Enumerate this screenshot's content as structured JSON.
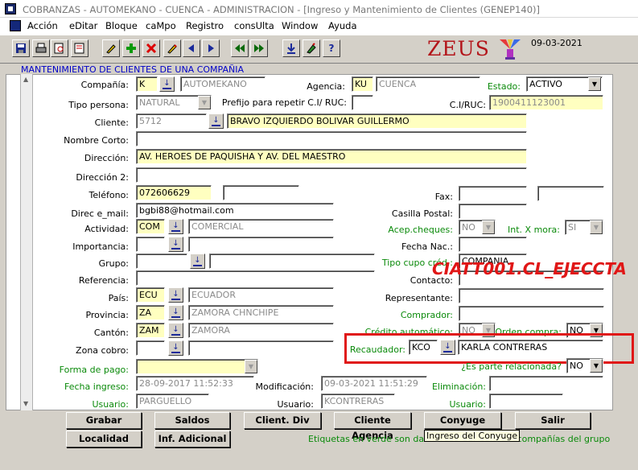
{
  "window": {
    "title": "COBRANZAS - AUTOMEKANO - CUENCA - ADMINISTRACION - [Ingreso y Mantenimiento de Clientes  (GENEP140)]"
  },
  "menu": [
    "Acción",
    "eDitar",
    "Bloque",
    "caMpo",
    "Registro",
    "consUlta",
    "Window",
    "Ayuda"
  ],
  "toolbar": {
    "icons": [
      "save-icon",
      "print-icon",
      "print-preview-icon",
      "search-icon",
      "add-record-icon",
      "delete-record-icon",
      "edit-icon",
      "previous-icon",
      "next-icon",
      "first-icon",
      "last-icon",
      "download-icon",
      "pen-icon",
      "help-icon"
    ],
    "brand": "ZEUS",
    "date": "09-03-2021"
  },
  "form": {
    "title": "MANTENIMIENTO DE CLIENTES DE UNA COMPAÑIA",
    "compania": {
      "label": "Compañía:",
      "code": "K",
      "name": "AUTOMEKANO"
    },
    "agencia": {
      "label": "Agencia:",
      "code": "KU",
      "name": "CUENCA"
    },
    "estado": {
      "label": "Estado:",
      "value": "ACTIVO"
    },
    "tipo_persona": {
      "label": "Tipo persona:",
      "value": "NATURAL"
    },
    "prefijo": {
      "label": "Prefijo para repetir C.I/ RUC:",
      "value": ""
    },
    "ci_ruc": {
      "label": "C.I/RUC:",
      "value": "1900411123001"
    },
    "cliente": {
      "label": "Cliente:",
      "code": "5712",
      "name": "BRAVO IZQUIERDO BOLIVAR GUILLERMO"
    },
    "nombre_corto": {
      "label": "Nombre Corto:",
      "value": ""
    },
    "direccion": {
      "label": "Dirección:",
      "value": "AV. HEROES DE PAQUISHA Y AV. DEL MAESTRO"
    },
    "direccion2": {
      "label": "Dirección 2:",
      "value": ""
    },
    "telefono": {
      "label": "Teléfono:",
      "value": "072606629",
      "value2": ""
    },
    "fax": {
      "label": "Fax:",
      "value": "",
      "value2": ""
    },
    "email": {
      "label": "Direc e_mail:",
      "value": "bgbi88@hotmail.com"
    },
    "casilla": {
      "label": "Casilla Postal:",
      "value": ""
    },
    "actividad": {
      "label": "Actividad:",
      "code": "COM",
      "name": "COMERCIAL"
    },
    "acep_cheques": {
      "label": "Acep.cheques:",
      "value": "NO"
    },
    "int_mora": {
      "label": "Int. X  mora:",
      "value": "SI"
    },
    "importancia": {
      "label": "Importancia:",
      "code": "",
      "name": ""
    },
    "fecha_nac": {
      "label": "Fecha Nac.:",
      "value": ""
    },
    "grupo": {
      "label": "Grupo:",
      "code": "",
      "name": ""
    },
    "tipo_cupo": {
      "label": "Tipo cupo créd.:",
      "value": "COMPANIA"
    },
    "referencia": {
      "label": "Referencia:",
      "value": ""
    },
    "contacto": {
      "label": "Contacto:",
      "value": ""
    },
    "pais": {
      "label": "País:",
      "code": "ECU",
      "name": "ECUADOR"
    },
    "representante": {
      "label": "Representante:",
      "value": ""
    },
    "provincia": {
      "label": "Provincia:",
      "code": "ZA",
      "name": "ZAMORA CHNCHIPE"
    },
    "comprador": {
      "label": "Comprador:",
      "value": ""
    },
    "canton": {
      "label": "Cantón:",
      "code": "ZAM",
      "name": "ZAMORA"
    },
    "credito_auto": {
      "label": "Crédito automático:",
      "value": "NO"
    },
    "orden_compra": {
      "label": "Orden compra:",
      "value": "NO"
    },
    "zona_cobro": {
      "label": "Zona cobro:",
      "code": "",
      "name": ""
    },
    "recaudador": {
      "label": "Recaudador:",
      "code": "KCO",
      "name": "KARLA CONTRERAS"
    },
    "parte_relacionada": {
      "label": "¿Es parte relacionada?",
      "value": "NO"
    },
    "forma_pago": {
      "label": "Forma de pago:",
      "value": ""
    },
    "fecha_ingreso": {
      "label": "Fecha ingreso:",
      "value": "28-09-2017 11:52:33"
    },
    "modificacion": {
      "label": "Modificación:",
      "value": "09-03-2021 11:51:29"
    },
    "eliminacion": {
      "label": "Eliminación:",
      "value": ""
    },
    "usuario1": {
      "label": "Usuario:",
      "value": "PARGUELLO"
    },
    "usuario2": {
      "label": "Usuario:",
      "value": "KCONTRERAS"
    },
    "usuario3": {
      "label": "Usuario:",
      "value": ""
    }
  },
  "buttons": {
    "grabar": "Grabar",
    "saldos": "Saldos",
    "cliente_div": "Client. Div",
    "cliente_agencia": "Cliente Agencia",
    "conyuge": "Conyuge",
    "salir": "Salir",
    "localidad": "Localidad",
    "inf_adicional": "Inf. Adicional"
  },
  "tooltip": "Ingreso del Conyuge",
  "note": "Etiquetas en verde son datos comunes a otras compañías del grupo",
  "overlay": {
    "text": "CIATT001.CL_EJECCTA"
  },
  "colors": {
    "accent_red": "#e01616",
    "green_label": "#0a8a0a",
    "title_blue": "#0000c8",
    "brand_red": "#b3151a"
  }
}
